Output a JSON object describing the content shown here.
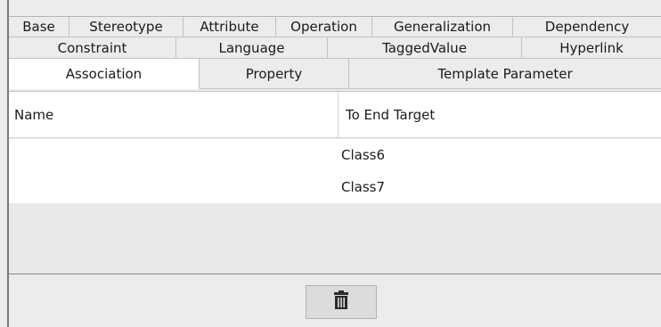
{
  "tabs": {
    "row1": [
      "Base",
      "Stereotype",
      "Attribute",
      "Operation",
      "Generalization",
      "Dependency"
    ],
    "row2": [
      "Constraint",
      "Language",
      "TaggedValue",
      "Hyperlink"
    ],
    "row3": [
      "Association",
      "Property",
      "Template Parameter"
    ],
    "active": "Association"
  },
  "table": {
    "columns": [
      "Name",
      "To End Target"
    ],
    "rows": [
      {
        "name": "",
        "target": "Class6"
      },
      {
        "name": "",
        "target": "Class7"
      }
    ]
  },
  "delete_button": {
    "icon": "trash-icon"
  }
}
